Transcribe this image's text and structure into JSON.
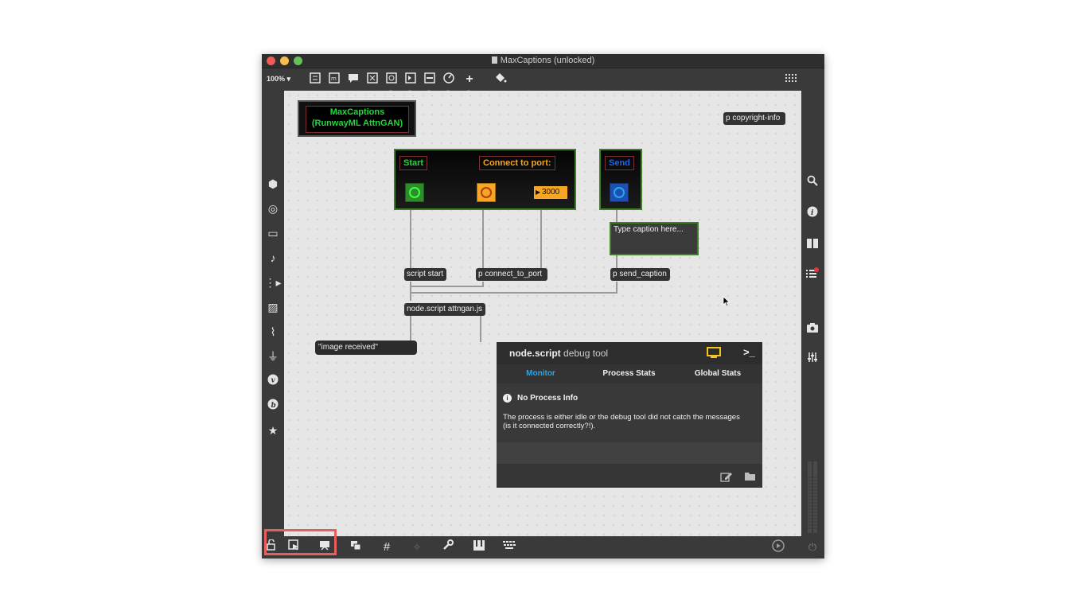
{
  "window": {
    "title": "MaxCaptions (unlocked)",
    "traffic_lights": {
      "close": "#ee5c54",
      "minimize": "#f5bd4f",
      "zoom": "#61c454"
    }
  },
  "toolbar": {
    "zoom": "100%",
    "icons": [
      "new-object-icon",
      "message-icon",
      "comment-icon",
      "button-icon",
      "toggle-icon",
      "number-icon",
      "playbar-icon",
      "slider-icon",
      "dial-icon",
      "add-icon",
      "paint-icon",
      "grid-pattern-icon"
    ]
  },
  "left_sidebar": [
    "cube-icon",
    "target-icon",
    "media-icon",
    "music-note-icon",
    "sequence-icon",
    "image-icon",
    "paperclip-icon",
    "plug-icon",
    "v-badge-icon",
    "b-badge-icon",
    "star-icon"
  ],
  "right_sidebar": [
    "search-icon",
    "info-icon",
    "panels-icon",
    "list-icon",
    "camera-icon",
    "mixer-icon"
  ],
  "bottom_bar": [
    "lock-icon",
    "presentation-select-icon",
    "presentation-mode-icon",
    "windows-icon",
    "grid-icon",
    "snap-icon",
    "wrench-icon",
    "piano-icon",
    "keyboard-icon",
    "playback-icon",
    "power-icon"
  ],
  "patch": {
    "title_panel": {
      "line1": "MaxCaptions",
      "line2": "(RunwayML AttnGAN)"
    },
    "copyright": "p copyright-info",
    "start_label": "Start",
    "connect_label": "Connect to port:",
    "port_value": "3000",
    "send_label": "Send",
    "caption_placeholder": "Type caption here...",
    "obj_script_start": "script start",
    "obj_connect": "p connect_to_port",
    "obj_send": "p send_caption",
    "obj_node": "node.script attngan.js",
    "msg_image": "\"image received\"",
    "colors": {
      "green": "#27d83a",
      "orange": "#f5a623",
      "blue": "#1e64e6",
      "accent_cyan": "#29a6e6",
      "highlight": "#e95d5d"
    }
  },
  "debug_tool": {
    "title_bold": "node.script",
    "title_rest": "debug tool",
    "tabs": [
      "Monitor",
      "Process Stats",
      "Global Stats"
    ],
    "active_tab": "Monitor",
    "info_title": "No Process Info",
    "info_text_line1": "The process is either idle or the debug tool did not catch the messages",
    "info_text_line2": "(is it connected correctly?!)."
  }
}
